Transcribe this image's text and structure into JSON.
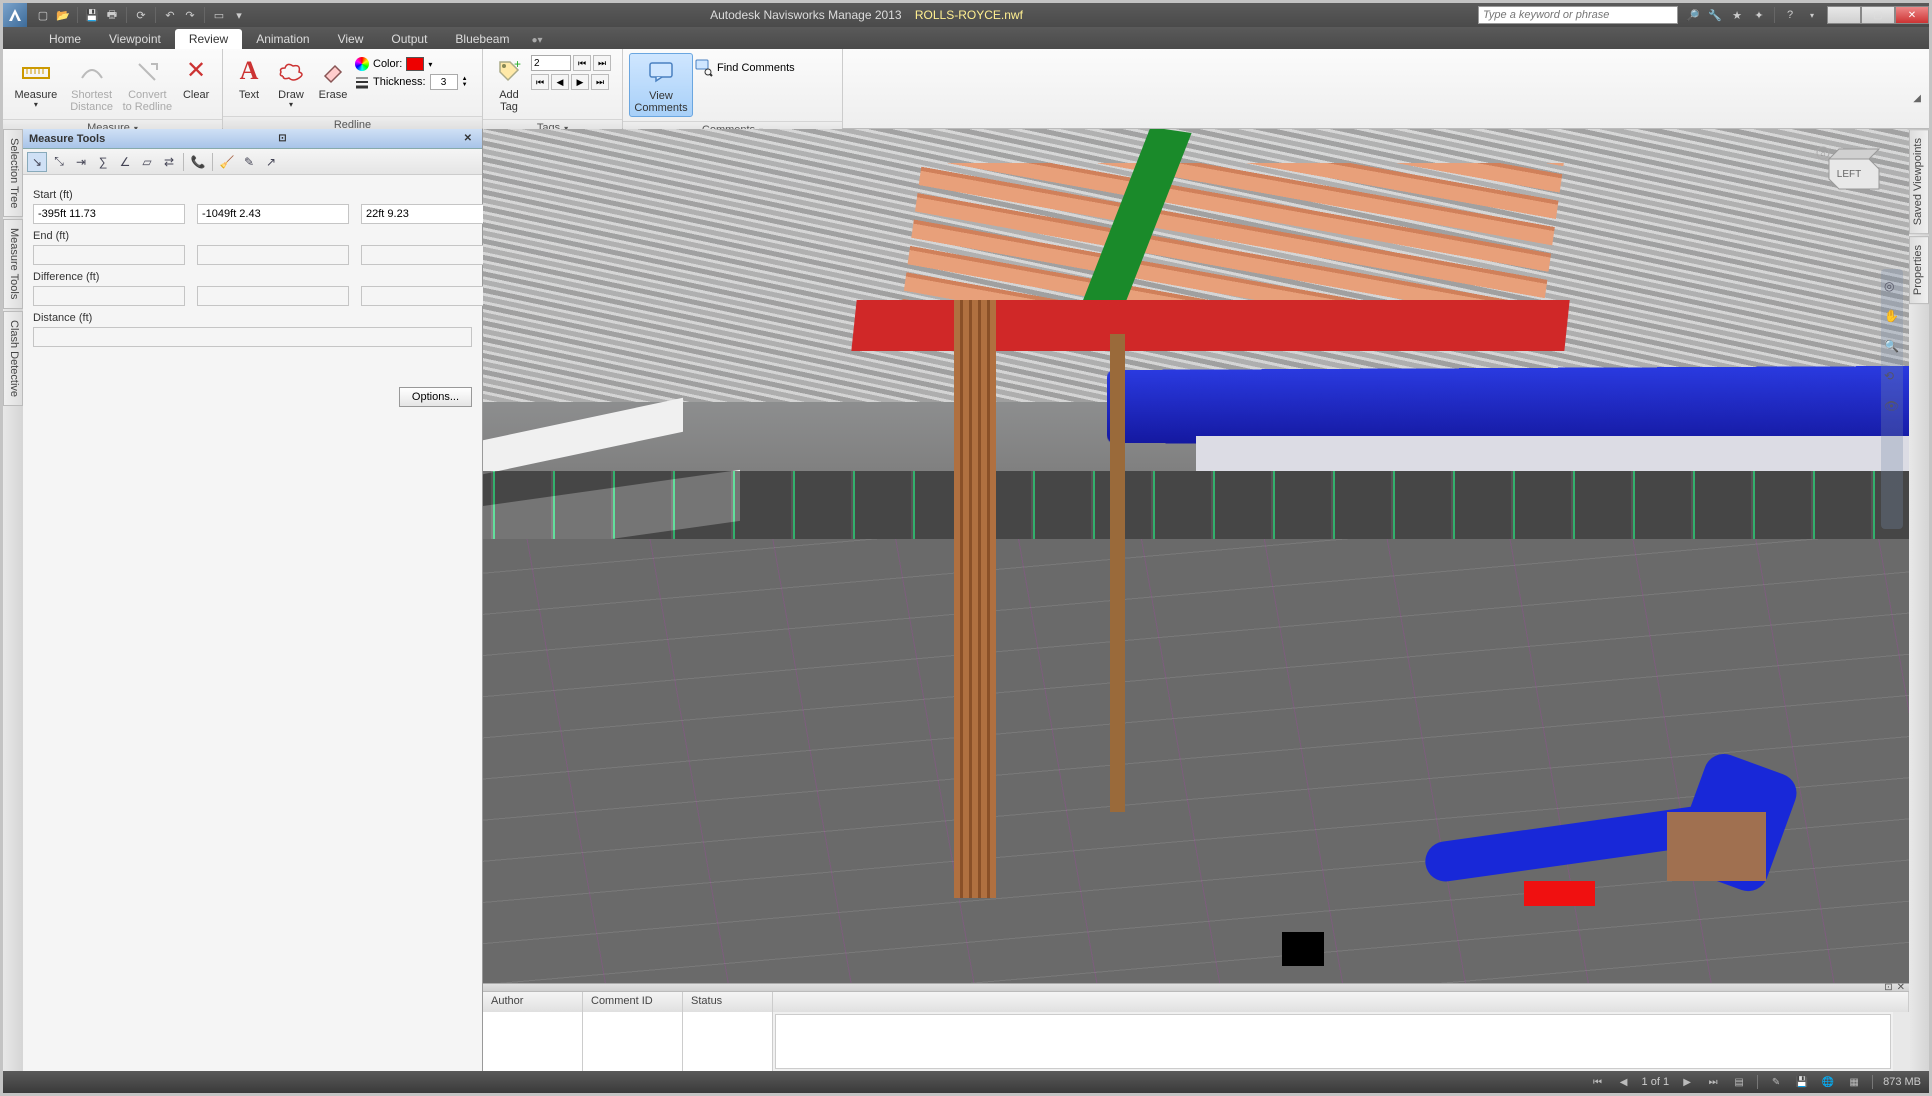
{
  "title": {
    "app": "Autodesk Navisworks Manage 2013",
    "file": "ROLLS-ROYCE.nwf"
  },
  "search_placeholder": "Type a keyword or phrase",
  "tabs": {
    "home": "Home",
    "viewpoint": "Viewpoint",
    "review": "Review",
    "animation": "Animation",
    "view": "View",
    "output": "Output",
    "bluebeam": "Bluebeam"
  },
  "ribbon": {
    "measure": {
      "measure": "Measure",
      "shortest": "Shortest Distance",
      "convert": "Convert to Redline",
      "clear": "Clear",
      "group": "Measure"
    },
    "redline": {
      "text": "Text",
      "draw": "Draw",
      "erase": "Erase",
      "color": "Color:",
      "thickness": "Thickness:",
      "thickness_val": "3",
      "group": "Redline"
    },
    "tags": {
      "add_tag": "Add Tag",
      "tag_num": "2",
      "group": "Tags"
    },
    "comments": {
      "view": "View Comments",
      "find": "Find Comments",
      "group": "Comments"
    }
  },
  "side_tabs_left": [
    "Selection Tree",
    "Measure Tools",
    "Clash Detective"
  ],
  "side_tabs_right": [
    "Saved Viewpoints",
    "Properties"
  ],
  "measure_panel": {
    "title": "Measure Tools",
    "start": "Start (ft)",
    "end": "End (ft)",
    "difference": "Difference (ft)",
    "distance": "Distance (ft)",
    "start_x": "-395ft 11.73",
    "start_y": "-1049ft 2.43",
    "start_z": "22ft 9.23",
    "options": "Options..."
  },
  "viewcube": "LEFT",
  "comments_pane": {
    "author": "Author",
    "comment_id": "Comment ID",
    "status": "Status"
  },
  "status": {
    "page": "1 of 1",
    "mem": "873 MB"
  }
}
